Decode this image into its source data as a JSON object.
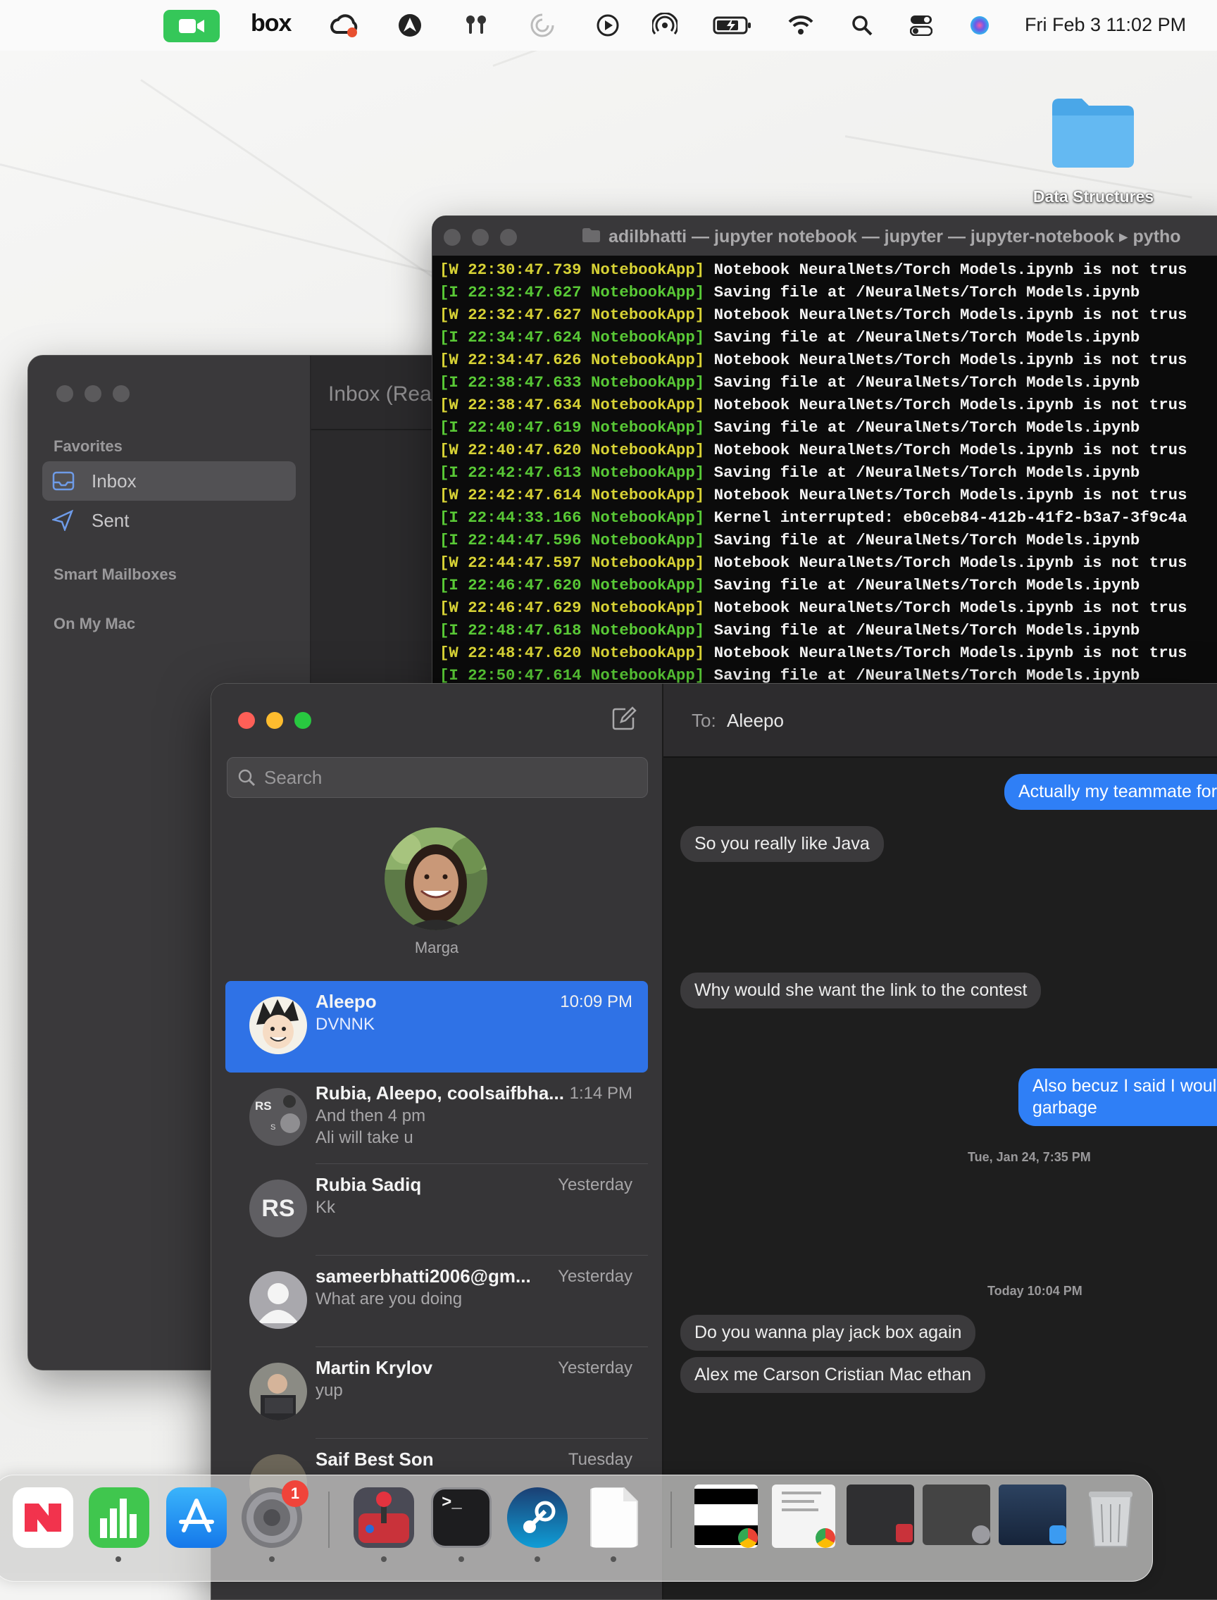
{
  "menubar": {
    "clock": "Fri Feb 3  11:02 PM",
    "box_label": "box",
    "icons": [
      "facetime-icon",
      "box-icon",
      "creative-cloud-icon",
      "airvpn-icon",
      "airpods-icon",
      "loading-icon",
      "play-icon",
      "airdrop-icon",
      "battery-icon",
      "wifi-icon",
      "search-icon",
      "control-center-icon",
      "siri-icon"
    ]
  },
  "desktop": {
    "folder_label": "Data Structures"
  },
  "mail": {
    "title": "Inbox (Rea",
    "sections": {
      "favorites": "Favorites",
      "smart": "Smart Mailboxes",
      "onmymac": "On My Mac"
    },
    "items": [
      {
        "label": "Inbox",
        "icon": "inbox-icon"
      },
      {
        "label": "Sent",
        "icon": "sent-icon"
      }
    ]
  },
  "terminal": {
    "title": "adilbhatti — jupyter notebook — jupyter — jupyter-notebook ▸ pytho",
    "lines": [
      {
        "prefix": "[W 22:30:47.739 NotebookApp]",
        "msg": " Notebook NeuralNets/Torch Models.ipynb is not trus",
        "level": "warn"
      },
      {
        "prefix": "[I 22:32:47.627 NotebookApp]",
        "msg": " Saving file at /NeuralNets/Torch Models.ipynb",
        "level": "info"
      },
      {
        "prefix": "[W 22:32:47.627 NotebookApp]",
        "msg": " Notebook NeuralNets/Torch Models.ipynb is not trus",
        "level": "warn"
      },
      {
        "prefix": "[I 22:34:47.624 NotebookApp]",
        "msg": " Saving file at /NeuralNets/Torch Models.ipynb",
        "level": "info"
      },
      {
        "prefix": "[W 22:34:47.626 NotebookApp]",
        "msg": " Notebook NeuralNets/Torch Models.ipynb is not trus",
        "level": "warn"
      },
      {
        "prefix": "[I 22:38:47.633 NotebookApp]",
        "msg": " Saving file at /NeuralNets/Torch Models.ipynb",
        "level": "info"
      },
      {
        "prefix": "[W 22:38:47.634 NotebookApp]",
        "msg": " Notebook NeuralNets/Torch Models.ipynb is not trus",
        "level": "warn"
      },
      {
        "prefix": "[I 22:40:47.619 NotebookApp]",
        "msg": " Saving file at /NeuralNets/Torch Models.ipynb",
        "level": "info"
      },
      {
        "prefix": "[W 22:40:47.620 NotebookApp]",
        "msg": " Notebook NeuralNets/Torch Models.ipynb is not trus",
        "level": "warn"
      },
      {
        "prefix": "[I 22:42:47.613 NotebookApp]",
        "msg": " Saving file at /NeuralNets/Torch Models.ipynb",
        "level": "info"
      },
      {
        "prefix": "[W 22:42:47.614 NotebookApp]",
        "msg": " Notebook NeuralNets/Torch Models.ipynb is not trus",
        "level": "warn"
      },
      {
        "prefix": "[I 22:44:33.166 NotebookApp]",
        "msg": " Kernel interrupted: eb0ceb84-412b-41f2-b3a7-3f9c4a",
        "level": "info"
      },
      {
        "prefix": "[I 22:44:47.596 NotebookApp]",
        "msg": " Saving file at /NeuralNets/Torch Models.ipynb",
        "level": "info"
      },
      {
        "prefix": "[W 22:44:47.597 NotebookApp]",
        "msg": " Notebook NeuralNets/Torch Models.ipynb is not trus",
        "level": "warn"
      },
      {
        "prefix": "[I 22:46:47.620 NotebookApp]",
        "msg": " Saving file at /NeuralNets/Torch Models.ipynb",
        "level": "info"
      },
      {
        "prefix": "[W 22:46:47.629 NotebookApp]",
        "msg": " Notebook NeuralNets/Torch Models.ipynb is not trus",
        "level": "warn"
      },
      {
        "prefix": "[I 22:48:47.618 NotebookApp]",
        "msg": " Saving file at /NeuralNets/Torch Models.ipynb",
        "level": "info"
      },
      {
        "prefix": "[W 22:48:47.620 NotebookApp]",
        "msg": " Notebook NeuralNets/Torch Models.ipynb is not trus",
        "level": "warn"
      },
      {
        "prefix": "[I 22:50:47.614 NotebookApp]",
        "msg": " Saving file at /NeuralNets/Torch Models.ipynb",
        "level": "info"
      }
    ]
  },
  "messages": {
    "search_placeholder": "Search",
    "pinned": {
      "name": "Marga"
    },
    "to_label": "To:",
    "to_name": "Aleepo",
    "conversations": [
      {
        "name": "Aleepo",
        "time": "10:09 PM",
        "preview": "DVNNK",
        "preview2": "",
        "avatar": "cartoon-avatar",
        "selected": true
      },
      {
        "name": "Rubia, Aleepo, coolsaifbha...",
        "time": "1:14 PM",
        "preview": "And then 4 pm",
        "preview2": "Ali will take u",
        "avatar": "group-avatar",
        "initials": "RS",
        "small_initial": "S"
      },
      {
        "name": "Rubia Sadiq",
        "time": "Yesterday",
        "preview": "Kk",
        "preview2": "",
        "avatar": "initials-avatar",
        "initials": "RS"
      },
      {
        "name": "sameerbhatti2006@gm...",
        "time": "Yesterday",
        "preview": "What are you doing",
        "preview2": "",
        "avatar": "person-avatar"
      },
      {
        "name": "Martin Krylov",
        "time": "Yesterday",
        "preview": "yup",
        "preview2": "",
        "avatar": "photo-avatar"
      },
      {
        "name": "Saif Best Son",
        "time": "Tuesday",
        "preview": "",
        "preview2": "",
        "avatar": "photo-avatar"
      }
    ],
    "thread": [
      {
        "kind": "out",
        "text": "Actually my teammate for"
      },
      {
        "kind": "in",
        "text": "So you really like Java"
      },
      {
        "kind": "in",
        "text": "Why would she want the link to the contest"
      },
      {
        "kind": "out",
        "text": "Also becuz I said I woul"
      },
      {
        "kind": "out",
        "text": "garbage"
      },
      {
        "kind": "stamp",
        "text": "Tue, Jan 24, 7:35 PM"
      },
      {
        "kind": "stamp",
        "text": "Today 10:04 PM"
      },
      {
        "kind": "in",
        "text": "Do you wanna play jack box again"
      },
      {
        "kind": "in",
        "text": "Alex me Carson Cristian Mac ethan"
      }
    ]
  },
  "dock": {
    "apps": [
      {
        "name": "news-icon"
      },
      {
        "name": "numbers-icon"
      },
      {
        "name": "app-store-icon"
      },
      {
        "name": "system-settings-icon",
        "badge": "1"
      },
      {
        "name": "joystick-app-icon"
      },
      {
        "name": "terminal-icon"
      },
      {
        "name": "steam-icon"
      },
      {
        "name": "document-icon"
      }
    ],
    "minimized": [
      {
        "name": "chrome-window-thumbnail"
      },
      {
        "name": "chrome-document-thumbnail"
      },
      {
        "name": "dark-window-thumbnail"
      },
      {
        "name": "settings-window-thumbnail"
      },
      {
        "name": "maps-window-thumbnail"
      },
      {
        "name": "trash-icon"
      }
    ],
    "terminal_prompt": ">_"
  }
}
